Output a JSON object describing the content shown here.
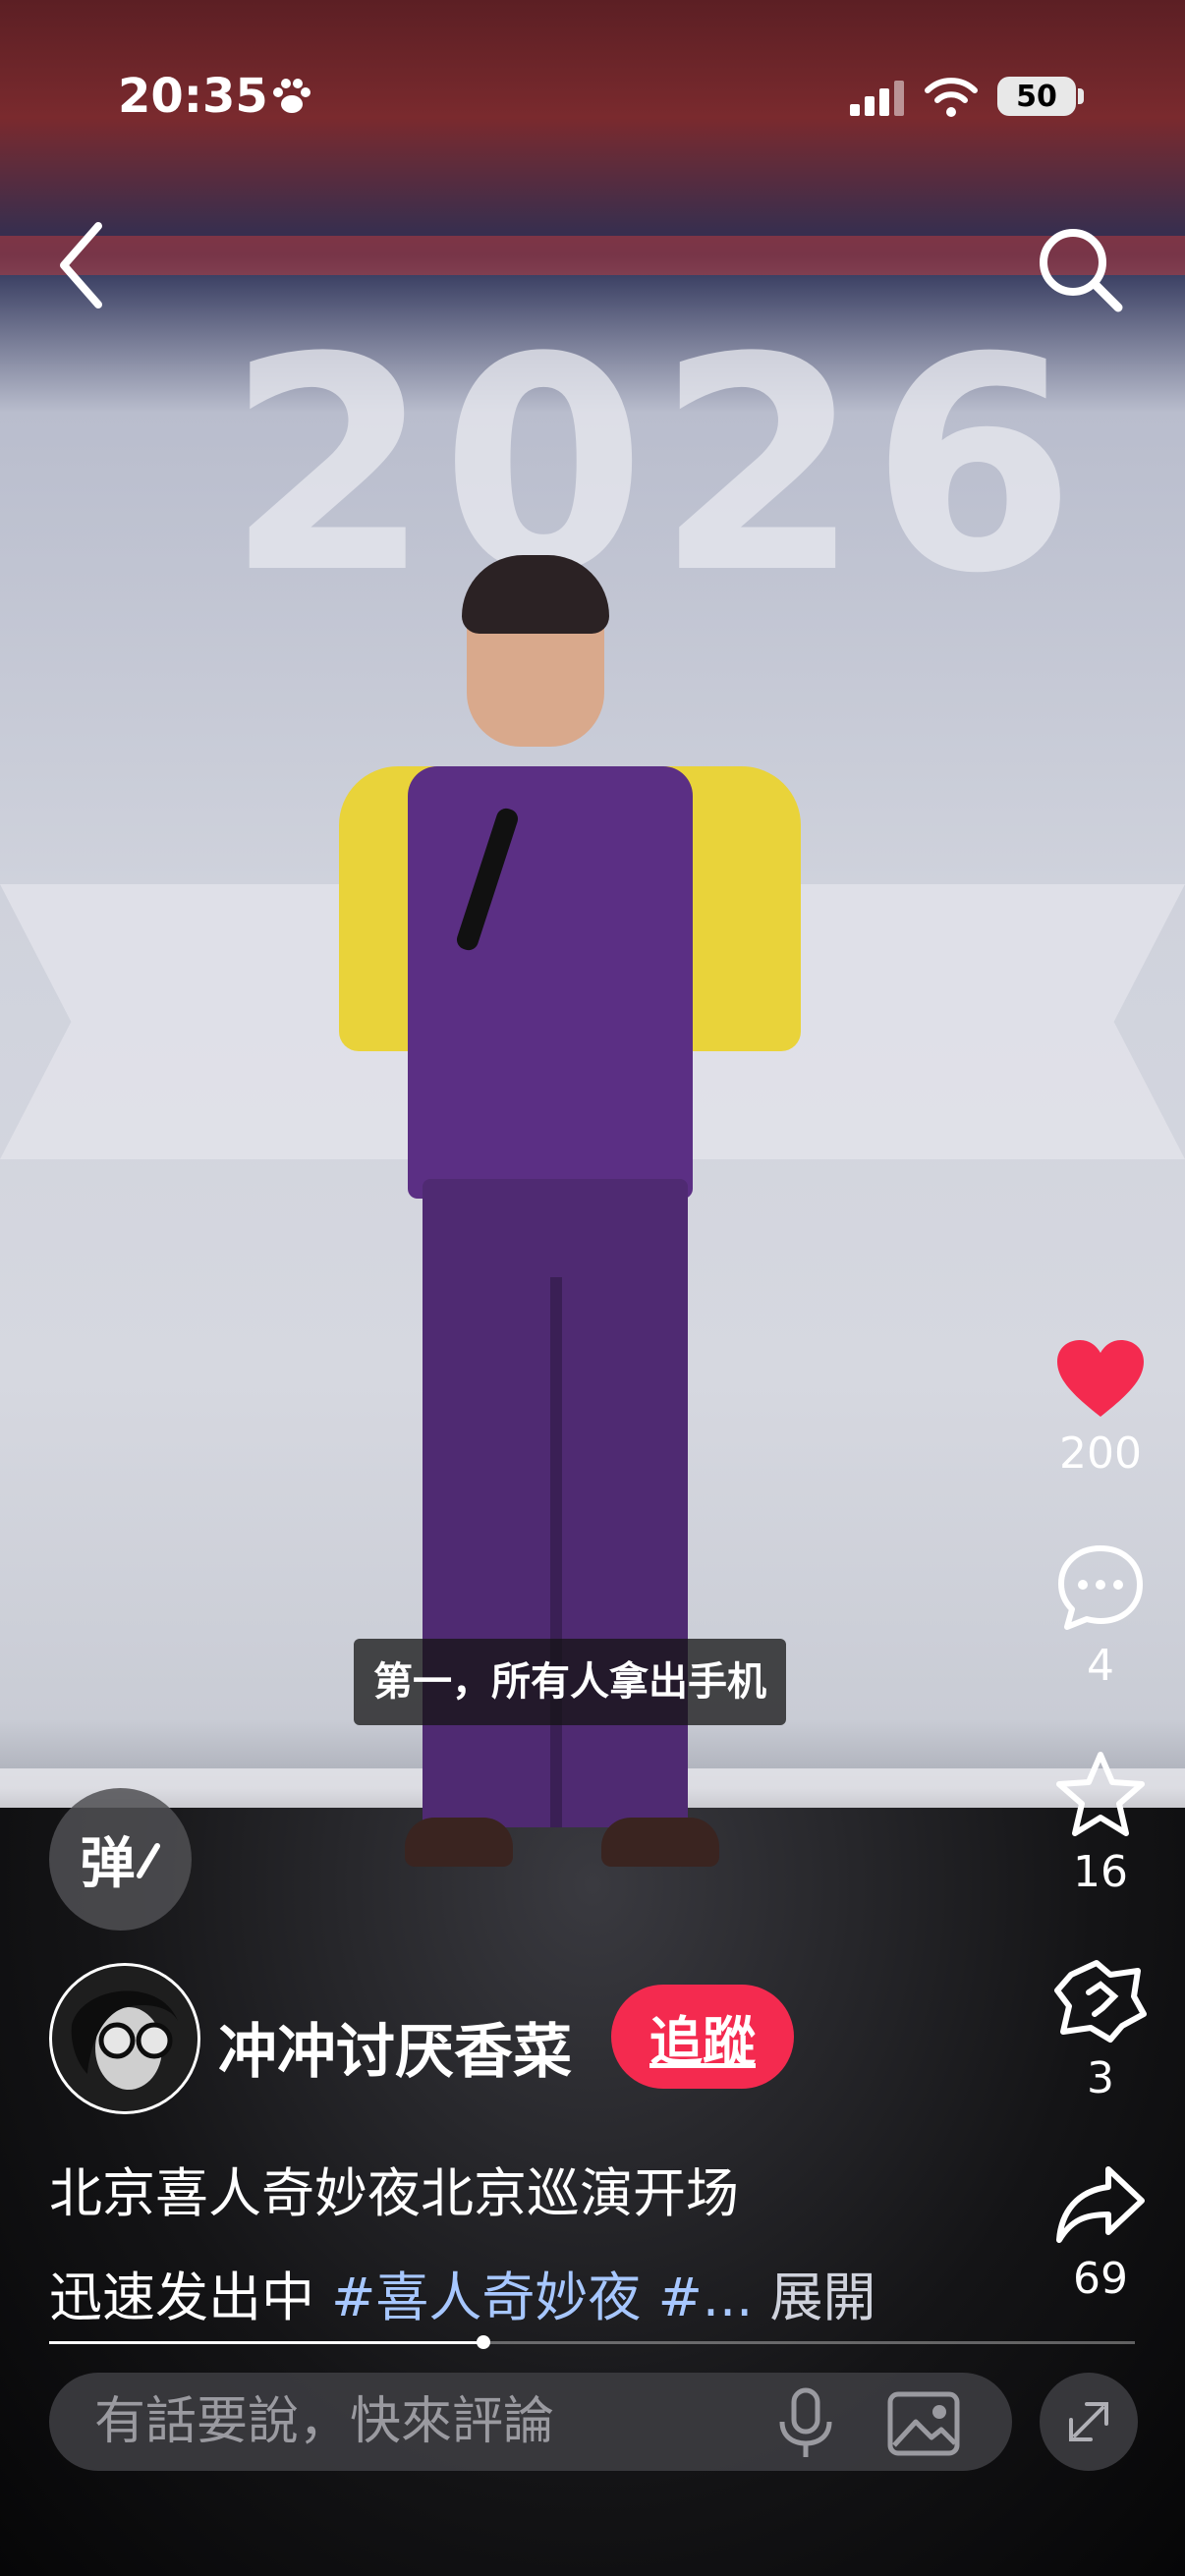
{
  "status_bar": {
    "time": "20:35",
    "battery": "50"
  },
  "icons": {
    "back": "chevron-left-icon",
    "search": "search-icon",
    "like": "heart-icon",
    "comment": "comment-bubble-icon",
    "collect": "star-icon",
    "gift": "gift-icon",
    "share": "share-arrow-icon",
    "mic": "microphone-icon",
    "image": "image-icon",
    "fullscreen": "fullscreen-exit-icon",
    "paw": "paw-icon"
  },
  "video": {
    "backdrop_text": "2026",
    "subtitle": "第一，所有人拿出手机",
    "progress": 0.4
  },
  "actions": {
    "like_count": "200",
    "comment_count": "4",
    "collect_count": "16",
    "gift_count": "3",
    "share_count": "69"
  },
  "danmaku_label": "弹",
  "author": {
    "name": "冲冲讨厌香菜",
    "follow_label": "追蹤"
  },
  "description": {
    "line1": "北京喜人奇妙夜北京巡演开场",
    "line2_text": "迅速发出中 ",
    "hashtag1": "#喜人奇妙夜",
    "hashtag2": " #...",
    "expand_label": " 展開"
  },
  "comment_bar": {
    "placeholder": "有話要說，快來評論"
  },
  "colors": {
    "like": "#f42a4f",
    "follow": "#f42a4f",
    "hashtag": "#a7c7ff"
  }
}
